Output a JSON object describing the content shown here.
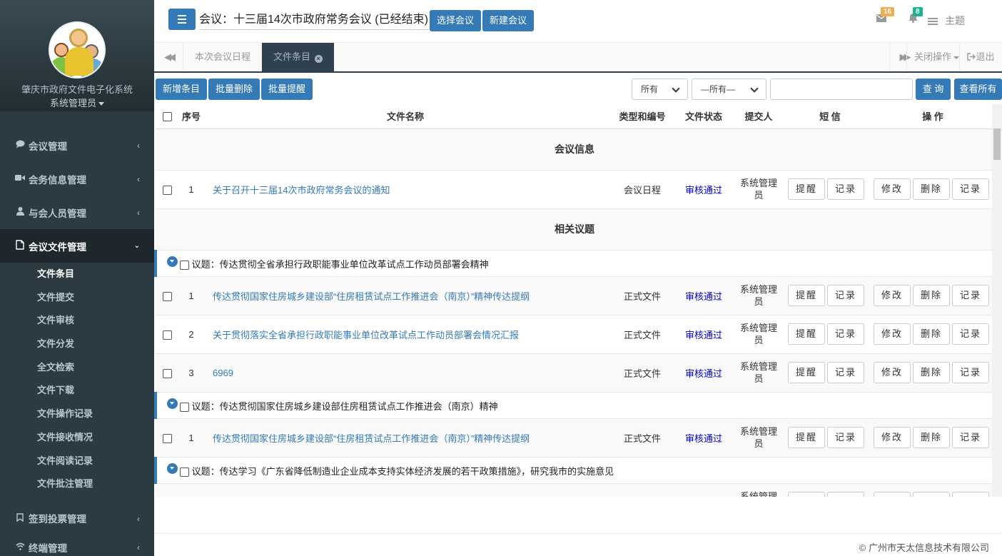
{
  "sidebar": {
    "org_name": "肇庆市政府文件电子化系统",
    "user_role": "系统管理员",
    "items": [
      {
        "label": "会议管理",
        "icon": "comment-icon"
      },
      {
        "label": "会务信息管理",
        "icon": "video-camera-icon"
      },
      {
        "label": "与会人员管理",
        "icon": "user-icon"
      },
      {
        "label": "会议文件管理",
        "icon": "file-icon"
      },
      {
        "label": "签到投票管理",
        "icon": "bookmark-icon"
      },
      {
        "label": "终端管理",
        "icon": "wifi-icon"
      }
    ],
    "sub_items": [
      "文件条目",
      "文件提交",
      "文件审核",
      "文件分发",
      "全文检索",
      "文件下载",
      "文件操作记录",
      "文件接收情况",
      "文件阅读记录",
      "文件批注管理"
    ]
  },
  "header": {
    "meeting_title": "会议：十三届14次市政府常务会议 (已经结束)",
    "select_meeting": "选择会议",
    "new_meeting": "新建会议",
    "mail_count": "16",
    "bell_count": "8",
    "mail_badge_color": "#f0ad4e",
    "bell_badge_color": "#1ab394",
    "theme_label": "主题"
  },
  "tabs": {
    "items": [
      "本次会议日程",
      "文件条目"
    ],
    "close_ops": "关闭操作",
    "logout": "退出"
  },
  "toolbar": {
    "add": "新增条目",
    "batch_delete": "批量删除",
    "batch_remind": "批量提醒",
    "filter1": "所有",
    "filter2": "—所有—",
    "search_value": "",
    "query": "查 询",
    "view_all": "查看所有"
  },
  "table": {
    "headers": {
      "no": "序号",
      "name": "文件名称",
      "type": "类型和编号",
      "status": "文件状态",
      "submitter": "提交人",
      "sms": "短 信",
      "ops": "操 作"
    },
    "section_meeting": "会议信息",
    "section_topics": "相关议题",
    "btn_remind": "提醒",
    "btn_record": "记录",
    "btn_edit": "修改",
    "btn_delete": "删除",
    "meeting_row": {
      "no": "1",
      "name": "关于召开十三届14次市政府常务会议的通知",
      "type": "会议日程",
      "status": "审核通过",
      "submitter": "系统管理员"
    },
    "topic1": "议题：传达贯彻全省承担行政职能事业单位改革试点工作动员部署会精神",
    "topic1_rows": [
      {
        "no": "1",
        "name": "传达贯彻国家住房城乡建设部“住房租赁试点工作推进会（南京）”精神传达提纲",
        "type": "正式文件",
        "status": "审核通过",
        "submitter": "系统管理员"
      },
      {
        "no": "2",
        "name": "关于贯彻落实全省承担行政职能事业单位改革试点工作动员部署会情况汇报",
        "type": "正式文件",
        "status": "审核通过",
        "submitter": "系统管理员"
      },
      {
        "no": "3",
        "name": "6969",
        "type": "正式文件",
        "status": "审核通过",
        "submitter": "系统管理员"
      }
    ],
    "topic2": "议题：传达贯彻国家住房城乡建设部住房租赁试点工作推进会（南京）精神",
    "topic2_rows": [
      {
        "no": "1",
        "name": "传达贯彻国家住房城乡建设部“住房租赁试点工作推进会（南京）”精神传达提纲",
        "type": "正式文件",
        "status": "审核通过",
        "submitter": "系统管理员"
      }
    ],
    "topic3": "议题：传达学习《广东省降低制造业企业成本支持实体经济发展的若干政策措施》，研究我市的实施意见",
    "topic3_partial_submitter": "系统管理员"
  },
  "footer": {
    "copyright": "© 广州市天太信息技术有限公司"
  }
}
